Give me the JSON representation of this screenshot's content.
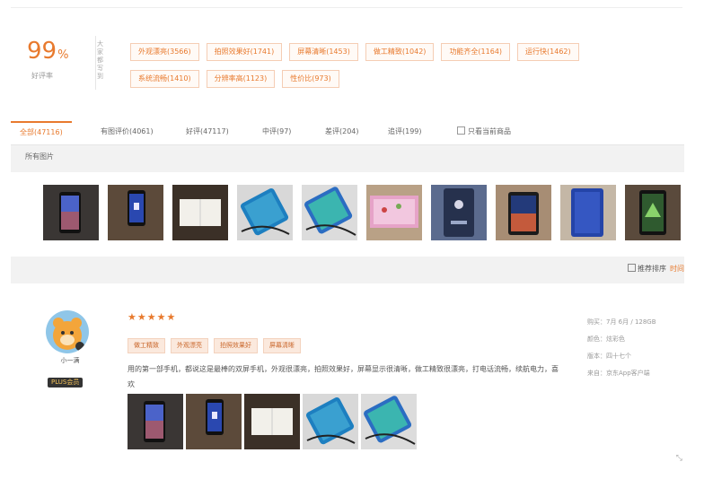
{
  "summary": {
    "score": "99",
    "score_unit": "%",
    "score_label": "好评率",
    "vertical_label": "大家都写到",
    "tags": [
      "外观漂亮(3566)",
      "拍照效果好(1741)",
      "屏幕清晰(1453)",
      "做工精致(1042)",
      "功能齐全(1164)",
      "运行快(1462)",
      "系统流畅(1410)",
      "分辨率高(1123)",
      "性价比(973)"
    ]
  },
  "tabs": [
    {
      "label": "全部(47116)"
    },
    {
      "label": "有图评价(4061)"
    },
    {
      "label": "好评(47117)"
    },
    {
      "label": "中评(97)"
    },
    {
      "label": "差评(204)"
    },
    {
      "label": "追评(199)"
    },
    {
      "label": "只看当前商品"
    }
  ],
  "all_pictures": {
    "label": "所有图片"
  },
  "sort": {
    "checkbox_label": "推荐排序",
    "link": "时间"
  },
  "review": {
    "username": "小一满",
    "badge": "PLUS会员",
    "stars": "★★★★★",
    "tags": [
      "做工精致",
      "外观漂亮",
      "拍照效果好",
      "屏幕清晰"
    ],
    "text": "用的第一部手机，都说这是最棒的双屏手机，外观很漂亮，拍照效果好，屏幕显示很清晰，做工精致很漂亮，打电话流畅，续航电力，喜欢",
    "meta": [
      "购买：7月 6月 / 128GB",
      "颜色：炫彩色",
      "版本：四十七个",
      "来自：京东App客户端"
    ]
  },
  "colors": {
    "accent": "#e87a2e"
  }
}
